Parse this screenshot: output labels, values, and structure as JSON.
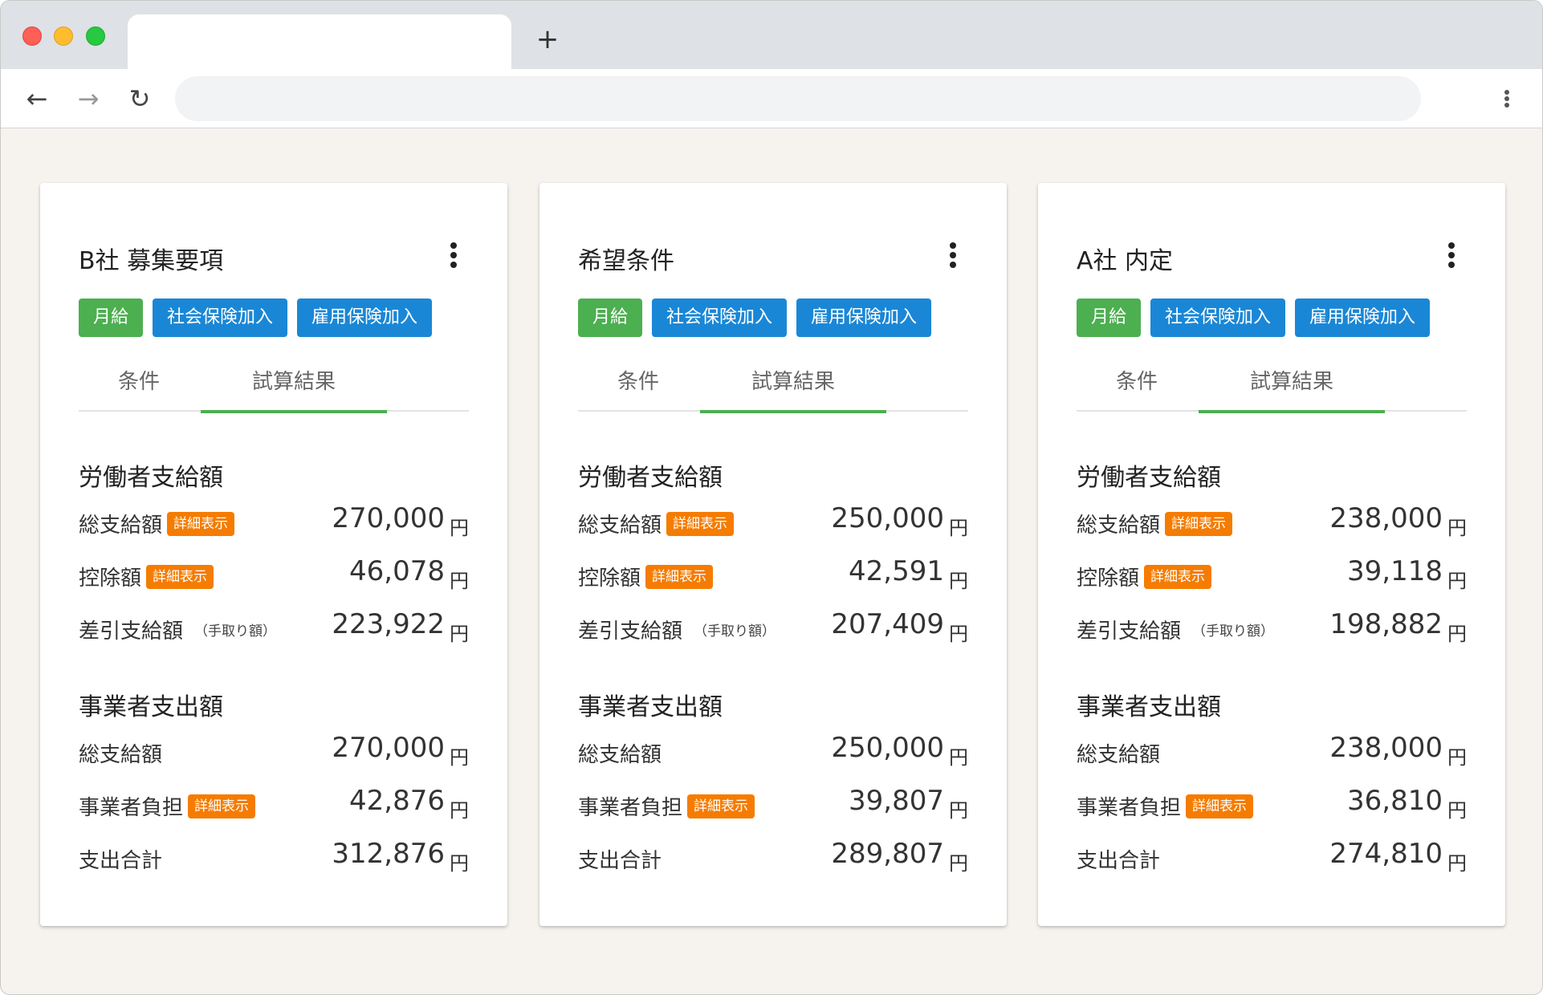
{
  "browser": {
    "new_tab_label": "+",
    "back_icon": "←",
    "forward_icon": "→",
    "reload_icon": "↻"
  },
  "cards": [
    {
      "title": "B社 募集要項",
      "chips": [
        "月給",
        "社会保険加入",
        "雇用保険加入"
      ],
      "tabs": [
        "条件",
        "試算結果"
      ],
      "active_tab": "試算結果",
      "worker": {
        "heading": "労働者支給額",
        "rows": [
          {
            "label": "総支給額",
            "badge": "詳細表示",
            "amount": "270,000",
            "unit": "円"
          },
          {
            "label": "控除額",
            "badge": "詳細表示",
            "amount": "46,078",
            "unit": "円"
          },
          {
            "label": "差引支給額",
            "note": "（手取り額）",
            "amount": "223,922",
            "unit": "円"
          }
        ]
      },
      "employer": {
        "heading": "事業者支出額",
        "rows": [
          {
            "label": "総支給額",
            "amount": "270,000",
            "unit": "円"
          },
          {
            "label": "事業者負担",
            "badge": "詳細表示",
            "amount": "42,876",
            "unit": "円"
          },
          {
            "label": "支出合計",
            "amount": "312,876",
            "unit": "円"
          }
        ]
      }
    },
    {
      "title": "希望条件",
      "chips": [
        "月給",
        "社会保険加入",
        "雇用保険加入"
      ],
      "tabs": [
        "条件",
        "試算結果"
      ],
      "active_tab": "試算結果",
      "worker": {
        "heading": "労働者支給額",
        "rows": [
          {
            "label": "総支給額",
            "badge": "詳細表示",
            "amount": "250,000",
            "unit": "円"
          },
          {
            "label": "控除額",
            "badge": "詳細表示",
            "amount": "42,591",
            "unit": "円"
          },
          {
            "label": "差引支給額",
            "note": "（手取り額）",
            "amount": "207,409",
            "unit": "円"
          }
        ]
      },
      "employer": {
        "heading": "事業者支出額",
        "rows": [
          {
            "label": "総支給額",
            "amount": "250,000",
            "unit": "円"
          },
          {
            "label": "事業者負担",
            "badge": "詳細表示",
            "amount": "39,807",
            "unit": "円"
          },
          {
            "label": "支出合計",
            "amount": "289,807",
            "unit": "円"
          }
        ]
      }
    },
    {
      "title": "A社 内定",
      "chips": [
        "月給",
        "社会保険加入",
        "雇用保険加入"
      ],
      "tabs": [
        "条件",
        "試算結果"
      ],
      "active_tab": "試算結果",
      "worker": {
        "heading": "労働者支給額",
        "rows": [
          {
            "label": "総支給額",
            "badge": "詳細表示",
            "amount": "238,000",
            "unit": "円"
          },
          {
            "label": "控除額",
            "badge": "詳細表示",
            "amount": "39,118",
            "unit": "円"
          },
          {
            "label": "差引支給額",
            "note": "（手取り額）",
            "amount": "198,882",
            "unit": "円"
          }
        ]
      },
      "employer": {
        "heading": "事業者支出額",
        "rows": [
          {
            "label": "総支給額",
            "amount": "238,000",
            "unit": "円"
          },
          {
            "label": "事業者負担",
            "badge": "詳細表示",
            "amount": "36,810",
            "unit": "円"
          },
          {
            "label": "支出合計",
            "amount": "274,810",
            "unit": "円"
          }
        ]
      }
    }
  ]
}
